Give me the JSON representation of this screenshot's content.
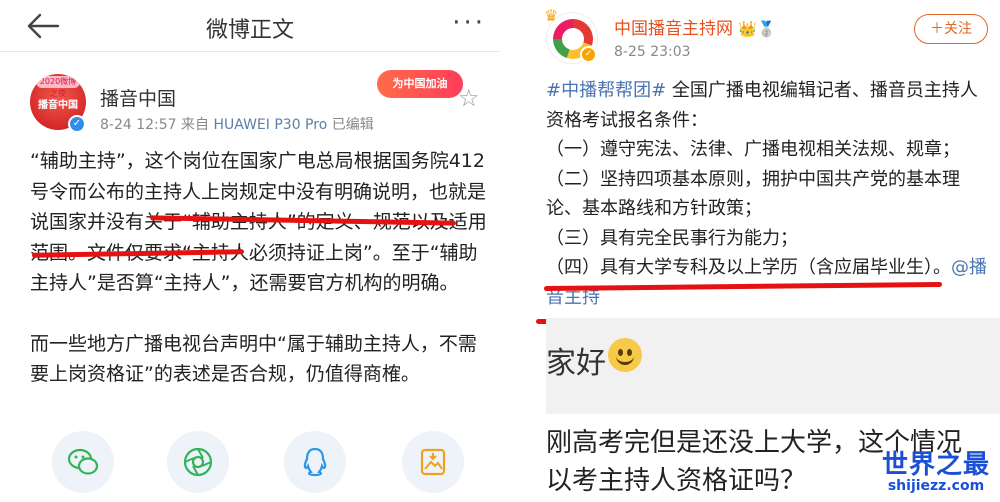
{
  "left": {
    "header": {
      "title": "微博正文",
      "more": "···"
    },
    "post": {
      "avatar_text": "播音中国",
      "avatar_badge": "2020微博之夜",
      "author": "播音中国",
      "date": "8-24 12:57",
      "from_label": "来自",
      "device": "HUAWEI P30 Pro",
      "edited": "已编辑",
      "event_badge": "为中国加油",
      "paragraph1": "“辅助主持”，这个岗位在国家广电总局根据国务院412号令而公布的主持人上岗规定中没有明确说明，也就是说国家并没有关于“辅助主持人”的定义、规范以及适用范围。文件仅要求“主持人必须持证上岗”。至于“辅助主持人”是否算“主持人”，还需要官方机构的明确。",
      "paragraph2": "而一些地方广播电视台声明中“属于辅助主持人，不需要上岗资格证”的表述是否合规，仍值得商榷。"
    },
    "share": [
      "wechat-icon",
      "moments-icon",
      "qq-icon",
      "save-image-icon"
    ]
  },
  "right": {
    "post": {
      "author": "中国播音主持网",
      "author_badges": "👑🥈",
      "time": "8-25 23:03",
      "follow": "＋关注",
      "hashtag": "#中播帮帮团#",
      "text_intro": " 全国广播电视编辑记者、播音员主持人资格考试报名条件：",
      "item1": "（一）遵守宪法、法律、广播电视相关法规、规章；",
      "item2": "（二）坚持四项基本原则，拥护中国共产党的基本理论、基本路线和方针政策；",
      "item3": "（三）具有完全民事行为能力；",
      "item4": "（四）具有大学专科及以上学历（含应届毕业生）。",
      "mention": "@播音主持"
    },
    "sub_card": {
      "text": "家好"
    },
    "question_line1": "刚高考完但是还没上大学，这个情况",
    "question_line2": "以考主持人资格证吗？"
  },
  "watermark": {
    "main": "世界之最",
    "sub": "shijiezz.com"
  },
  "colors": {
    "underline": "#e51212",
    "link": "#4a74b0",
    "brand_orange": "#e8501e",
    "watermark": "#1a4fd6"
  }
}
